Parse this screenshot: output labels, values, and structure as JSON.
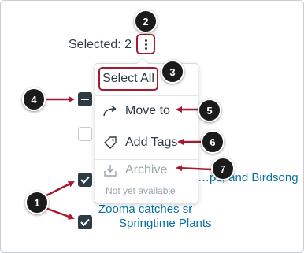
{
  "toolbar": {
    "selected_text": "Selected: 2",
    "more_options_icon": "kebab-vertical-icon"
  },
  "menu": {
    "select_all": "Select All",
    "move_to": "Move to",
    "add_tags": "Add Tags",
    "archive": "Archive",
    "archive_note": "Not yet available",
    "icons": [
      "move-arrow-icon",
      "tag-icon",
      "archive-icon"
    ]
  },
  "list": {
    "items": [
      {
        "checkbox": "indeterminate",
        "title": ""
      },
      {
        "checkbox": "unchecked",
        "title": ""
      },
      {
        "checkbox": "checked",
        "title": "…ps, and Birdsong"
      },
      {
        "checkbox": "checked",
        "title_line1": "Zooma catches sr",
        "title_line2": "Springtime Plants"
      }
    ]
  },
  "callouts": [
    "1",
    "2",
    "3",
    "4",
    "5",
    "6",
    "7"
  ],
  "colors": {
    "callout_bg": "#1b1b1b",
    "arrow": "#a6192e",
    "highlight_border": "#a6192e",
    "checkbox": "#2d3b45",
    "link": "#0770a3"
  }
}
